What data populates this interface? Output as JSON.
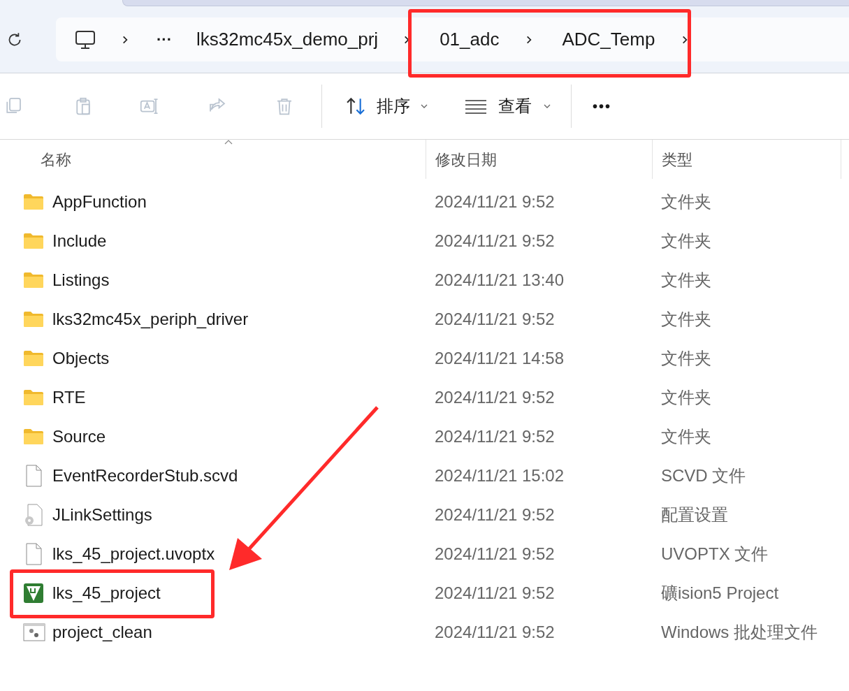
{
  "breadcrumb": {
    "more": "···",
    "items": [
      {
        "label": "lks32mc45x_demo_prj"
      },
      {
        "label": "01_adc"
      },
      {
        "label": "ADC_Temp"
      }
    ]
  },
  "toolbar": {
    "sort": "排序",
    "view": "查看",
    "more": "•••"
  },
  "columns": [
    {
      "label": "名称",
      "sorted": true
    },
    {
      "label": "修改日期",
      "sorted": false
    },
    {
      "label": "类型",
      "sorted": false
    }
  ],
  "files": [
    {
      "kind": "folder",
      "name": "AppFunction",
      "modified": "2024/11/21 9:52",
      "type": "文件夹"
    },
    {
      "kind": "folder",
      "name": "Include",
      "modified": "2024/11/21 9:52",
      "type": "文件夹"
    },
    {
      "kind": "folder",
      "name": "Listings",
      "modified": "2024/11/21 13:40",
      "type": "文件夹"
    },
    {
      "kind": "folder",
      "name": "lks32mc45x_periph_driver",
      "modified": "2024/11/21 9:52",
      "type": "文件夹"
    },
    {
      "kind": "folder",
      "name": "Objects",
      "modified": "2024/11/21 14:58",
      "type": "文件夹"
    },
    {
      "kind": "folder",
      "name": "RTE",
      "modified": "2024/11/21 9:52",
      "type": "文件夹"
    },
    {
      "kind": "folder",
      "name": "Source",
      "modified": "2024/11/21 9:52",
      "type": "文件夹"
    },
    {
      "kind": "file",
      "name": "EventRecorderStub.scvd",
      "modified": "2024/11/21 15:02",
      "type": "SCVD 文件"
    },
    {
      "kind": "settings",
      "name": "JLinkSettings",
      "modified": "2024/11/21 9:52",
      "type": "配置设置"
    },
    {
      "kind": "file",
      "name": "lks_45_project.uvoptx",
      "modified": "2024/11/21 9:52",
      "type": "UVOPTX 文件"
    },
    {
      "kind": "project",
      "name": "lks_45_project",
      "modified": "2024/11/21 9:52",
      "type": "礦ision5 Project"
    },
    {
      "kind": "batch",
      "name": "project_clean",
      "modified": "2024/11/21 9:52",
      "type": "Windows 批处理文件"
    }
  ]
}
